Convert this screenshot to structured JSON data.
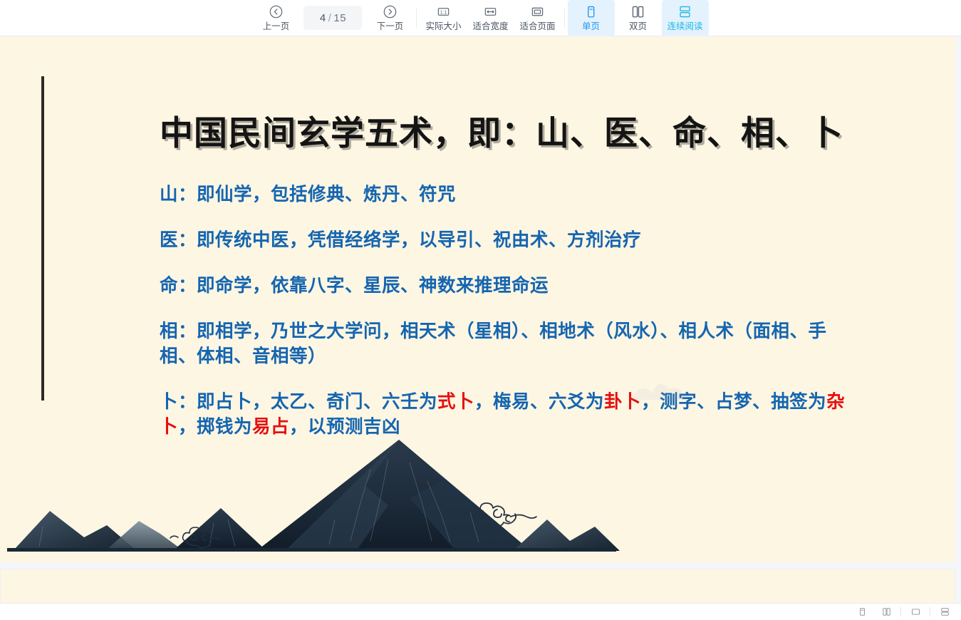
{
  "toolbar": {
    "prev_page": {
      "label": "上一页",
      "icon": "chevron-left-circle-icon"
    },
    "page_indicator": {
      "current": "4",
      "separator": "/",
      "total": "15"
    },
    "next_page": {
      "label": "下一页",
      "icon": "chevron-right-circle-icon"
    },
    "actual_size": {
      "label": "实际大小",
      "icon": "one-to-one-icon"
    },
    "fit_width": {
      "label": "适合宽度",
      "icon": "fit-width-icon"
    },
    "fit_page": {
      "label": "适合页面",
      "icon": "fit-page-icon"
    },
    "single_page": {
      "label": "单页",
      "icon": "single-page-icon",
      "state": "active"
    },
    "double_page": {
      "label": "双页",
      "icon": "double-page-icon",
      "state": "inactive"
    },
    "continuous_read": {
      "label": "连续阅读",
      "icon": "continuous-scroll-icon",
      "state": "active"
    }
  },
  "document": {
    "title": "中国民间玄学五术，即：山、医、命、相、卜",
    "paragraphs": [
      {
        "text": "山：即仙学，包括修典、炼丹、符咒"
      },
      {
        "text": "医：即传统中医，凭借经络学，以导引、祝由术、方剂治疗"
      },
      {
        "text": "命：即命学，依靠八字、星辰、神数来推理命运"
      },
      {
        "text": "相：即相学，乃世之大学问，相天术（星相）、相地术（风水）、相人术（面相、手相、体相、音相等）"
      }
    ],
    "divination_paragraph": {
      "seg1": "卜：即占卜，太乙、奇门、六壬为",
      "hl1": "式卜",
      "seg2": "，梅易、六爻为",
      "hl2": "卦卜",
      "seg3": "，测字、占梦、抽签为",
      "hl3": "杂卜",
      "seg4": "，掷钱为",
      "hl4": "易占",
      "seg5": "，以预测吉凶"
    },
    "artwork": "ink-mountain-landscape-with-auspicious-clouds"
  },
  "statusbar": {
    "single_page": {
      "icon": "single-page-icon"
    },
    "double_page": {
      "icon": "double-page-icon"
    },
    "fit_page": {
      "icon": "fit-page-icon"
    },
    "continuous": {
      "icon": "continuous-scroll-icon"
    }
  },
  "colors": {
    "page_background": "#fdf6e3",
    "body_text": "#1565b0",
    "highlight_text": "#e41010",
    "title_text": "#141414",
    "accent": "#2196f3",
    "accent_cyan": "#18b8e8"
  }
}
